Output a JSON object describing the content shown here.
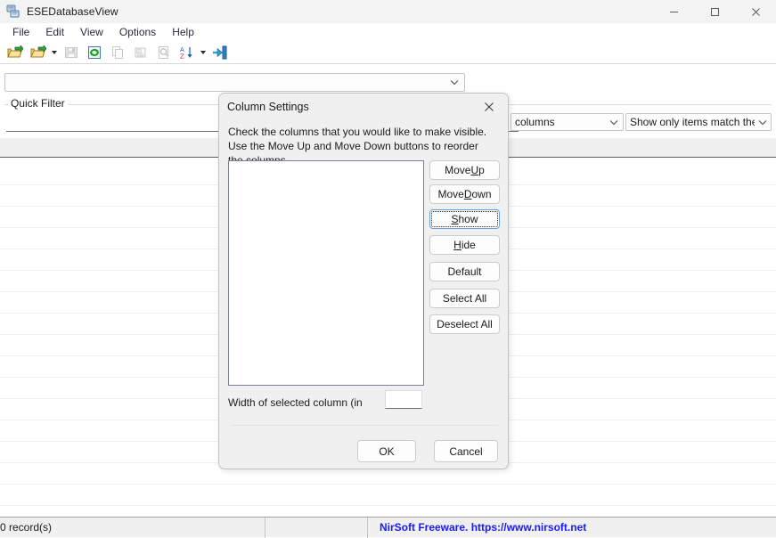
{
  "window": {
    "title": "ESEDatabaseView",
    "icon": "app-database-icon",
    "controls": {
      "minimize": "Minimize",
      "maximize": "Maximize",
      "close": "Close"
    }
  },
  "menubar": {
    "items": [
      {
        "label": "File"
      },
      {
        "label": "Edit"
      },
      {
        "label": "View"
      },
      {
        "label": "Options"
      },
      {
        "label": "Help"
      }
    ]
  },
  "toolbar": {
    "buttons": [
      {
        "name": "open-folder-icon",
        "enabled": true
      },
      {
        "name": "open-recent-folder-icon",
        "enabled": true,
        "dropdown": true
      },
      {
        "name": "save-icon",
        "enabled": false
      },
      {
        "name": "refresh-icon",
        "enabled": true
      },
      {
        "name": "copy-icon",
        "enabled": false
      },
      {
        "name": "properties-icon",
        "enabled": false
      },
      {
        "name": "find-icon",
        "enabled": false
      },
      {
        "name": "sort-az-icon",
        "enabled": true,
        "dropdown": true
      },
      {
        "name": "exit-icon",
        "enabled": true
      }
    ]
  },
  "filter_bar": {
    "table_combo_value": "",
    "table_combo_placeholder": ""
  },
  "quick_filter": {
    "legend": "Quick Filter",
    "input_value": "",
    "input_placeholder": "",
    "columns_combo_value": "columns",
    "mode_combo_value": "Show only items match the f"
  },
  "listview": {
    "columns": [],
    "rows": []
  },
  "statusbar": {
    "records": "0 record(s)",
    "middle": "",
    "link": "NirSoft Freeware. https://www.nirsoft.net",
    "link_color": "#1a1aff"
  },
  "dialog": {
    "title": "Column Settings",
    "close_label": "Close",
    "description": "Check the columns that you would like to make visible. Use the Move Up and Move Down buttons to reorder the columns",
    "listbox_items": [],
    "buttons": {
      "move_up": {
        "pre": "Move ",
        "accel": "U",
        "post": "p"
      },
      "move_down": {
        "pre": "Move ",
        "accel": "D",
        "post": "own"
      },
      "show": {
        "pre": "",
        "accel": "S",
        "post": "how",
        "focused": true
      },
      "hide": {
        "pre": "",
        "accel": "H",
        "post": "ide"
      },
      "default": {
        "pre": "Defaul",
        "accel": "",
        "post": "t"
      },
      "select_all": {
        "pre": "Select All",
        "accel": "",
        "post": ""
      },
      "deselect_all": {
        "pre": "Deselect All",
        "accel": "",
        "post": ""
      }
    },
    "width_label": "Width of selected column (in",
    "width_value": "",
    "ok_label": "OK",
    "cancel_label": "Cancel"
  }
}
